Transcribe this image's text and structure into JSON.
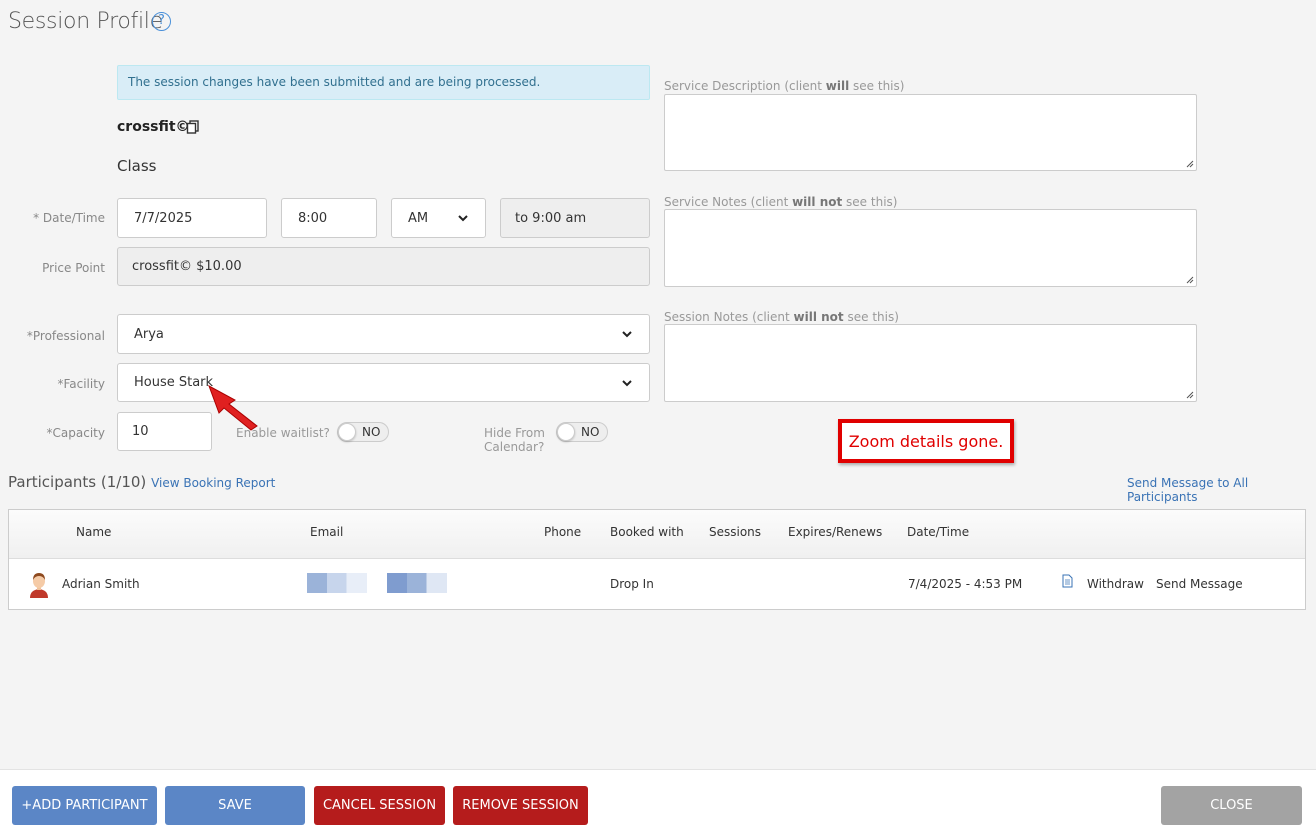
{
  "header": {
    "title": "Session Profile",
    "help_icon": "?"
  },
  "alert": {
    "message": "The session changes have been submitted and are being processed."
  },
  "service": {
    "name": "crossfit©",
    "type": "Class"
  },
  "form": {
    "date_label": "* Date/Time",
    "date_value": "7/7/2025",
    "time_value": "8:00",
    "ampm_value": "AM",
    "end_time": "to 9:00 am",
    "price_label": "Price Point",
    "price_value": "crossfit© $10.00",
    "professional_label": "*Professional",
    "professional_value": "Arya",
    "facility_label": "*Facility",
    "facility_value": "House Stark",
    "capacity_label": "*Capacity",
    "capacity_value": "10",
    "waitlist_label": "Enable waitlist?",
    "waitlist_value": "NO",
    "hide_label_1": "Hide From",
    "hide_label_2": "Calendar?",
    "hide_value": "NO"
  },
  "notes": {
    "desc_label_pre": "Service Description (client ",
    "desc_label_bold": "will",
    "desc_label_post": " see this)",
    "service_notes_pre": "Service Notes (client ",
    "service_notes_bold": "will not",
    "service_notes_post": " see this)",
    "session_notes_pre": "Session Notes (client ",
    "session_notes_bold": "will not",
    "session_notes_post": " see this)"
  },
  "callout": {
    "text": "Zoom details gone."
  },
  "participants": {
    "title": "Participants (1/10)",
    "view_report": "View Booking Report",
    "send_all": "Send Message to All Participants",
    "columns": [
      "Name",
      "Email",
      "Phone",
      "Booked with",
      "Sessions",
      "Expires/Renews",
      "Date/Time"
    ],
    "rows": [
      {
        "name": "Adrian Smith",
        "booked_with": "Drop In",
        "datetime": "7/4/2025 - 4:53 PM",
        "withdraw": "Withdraw",
        "send_message": "Send Message"
      }
    ]
  },
  "buttons": {
    "add": "+ADD PARTICIPANT",
    "save": "SAVE",
    "cancel": "CANCEL SESSION",
    "remove": "REMOVE SESSION",
    "close": "CLOSE"
  },
  "colors": {
    "primary": "#5b86c6",
    "danger": "#b51c1c",
    "link": "#3a73b5",
    "alert_bg": "#d9edf7",
    "callout": "#e00000"
  }
}
